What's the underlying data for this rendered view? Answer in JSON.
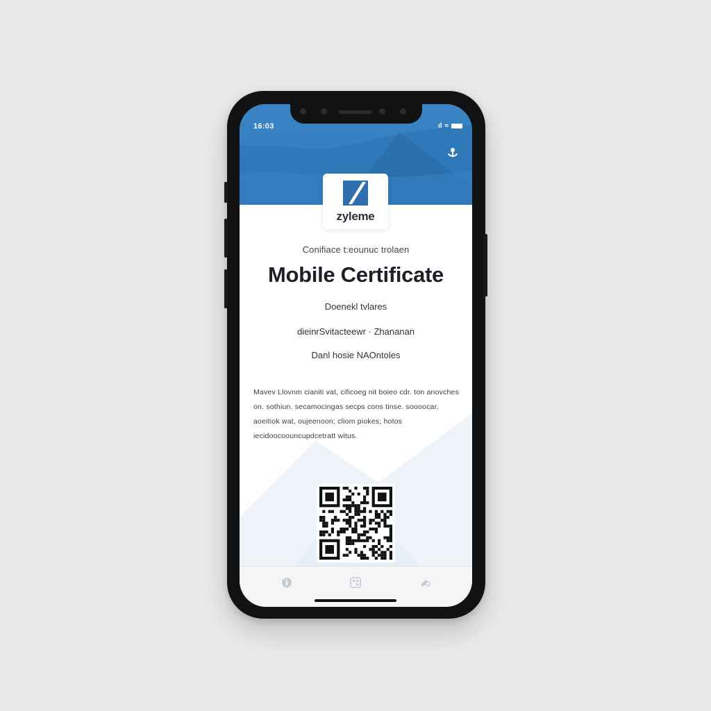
{
  "status_bar": {
    "time": "16:03",
    "signal": "ıl",
    "wifi": "≈"
  },
  "header": {
    "share_icon": "share-icon",
    "accent_color": "#2f7bbd"
  },
  "logo": {
    "text": "zyleme",
    "mark_icon": "zyleme-logo-mark"
  },
  "certificate": {
    "subtitle": "Conifiace t:eounuc trolaen",
    "title": "Mobile Certificate",
    "recipient": "Doenekl tvlares",
    "details": "dieinrSvitacteewr  ·  Zhananan",
    "date_line": "Danl hosie NAOntoles",
    "paragraph": "Mavev Llovnm  cianiti vat, cificoeg nit boieo cdr.  ton anovches on. sothiun. secamocingas secps cons tinse. soooocar. aoeitiok wat, oujeenoon;  cliom piokes;  hotos iecidoocoouncupdcetratt witus."
  },
  "qr": {
    "label": "qr-code"
  },
  "tab_bar": {
    "items": [
      {
        "icon": "info-icon"
      },
      {
        "icon": "qr-scan-icon"
      },
      {
        "icon": "settings-icon"
      }
    ]
  }
}
